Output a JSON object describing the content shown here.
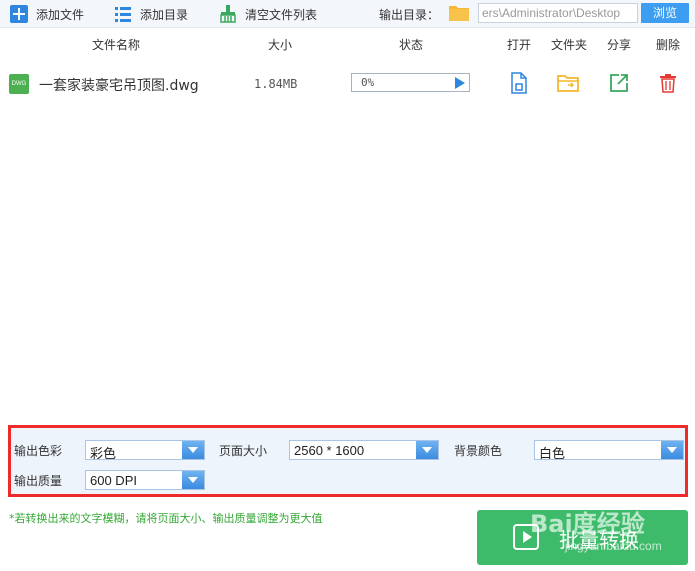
{
  "toolbar": {
    "add_file": "添加文件",
    "add_dir": "添加目录",
    "clear_list": "清空文件列表",
    "output_dir_label": "输出目录：",
    "output_path": "ers\\Administrator\\Desktop",
    "browse": "浏览"
  },
  "columns": {
    "name": "文件名称",
    "size": "大小",
    "status": "状态",
    "open": "打开",
    "folder": "文件夹",
    "share": "分享",
    "delete": "删除"
  },
  "files": [
    {
      "icon_text": "DWG",
      "name": "一套家装豪宅吊顶图.dwg",
      "size": "1.84MB",
      "progress_text": "0%",
      "progress": 0
    }
  ],
  "settings": {
    "color_label": "输出色彩",
    "color_value": "彩色",
    "page_size_label": "页面大小",
    "page_size_value": "2560 * 1600",
    "bg_color_label": "背景颜色",
    "bg_color_value": "白色",
    "quality_label": "输出质量",
    "quality_value": "600 DPI"
  },
  "tip": "*若转换出来的文字模糊，请将页面大小、输出质量调整为更大值",
  "convert_button": "批量转换",
  "watermark": {
    "main": "Bai度经验",
    "sub": "jingyan.baidu.com"
  },
  "colors": {
    "accent_blue": "#2e86de",
    "convert_green": "#3dbb6a",
    "highlight_red": "#ee2a2a",
    "tip_green": "#36a836",
    "folder_yellow": "#f5b82e",
    "delete_red": "#e53935"
  }
}
